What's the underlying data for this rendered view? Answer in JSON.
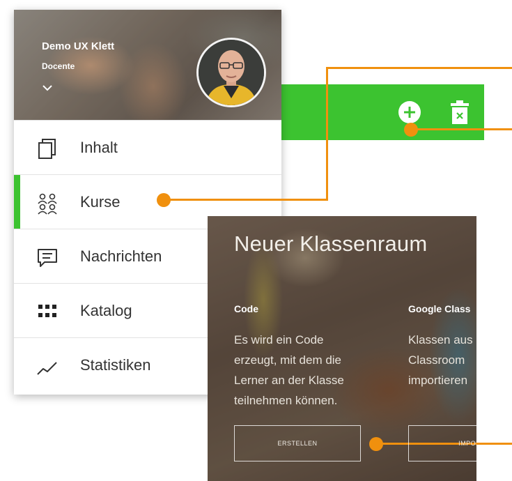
{
  "profile": {
    "name": "Demo UX Klett",
    "role": "Docente"
  },
  "menu": {
    "items": [
      {
        "label": "Inhalt",
        "icon": "stack-pages-icon",
        "active": false
      },
      {
        "label": "Kurse",
        "icon": "people-group-icon",
        "active": true
      },
      {
        "label": "Nachrichten",
        "icon": "message-icon",
        "active": false
      },
      {
        "label": "Katalog",
        "icon": "grid-icon",
        "active": false
      },
      {
        "label": "Statistiken",
        "icon": "line-chart-icon",
        "active": false
      }
    ]
  },
  "toolbar": {
    "add_icon": "plus-circle-icon",
    "delete_icon": "trash-icon"
  },
  "classroom": {
    "title": "Neuer Klassenraum",
    "options": [
      {
        "heading": "Code",
        "lines": [
          "Es wird ein Code",
          "erzeugt, mit dem die",
          "Lerner an der Klasse",
          "teilnehmen können."
        ],
        "button": "ERSTELLEN"
      },
      {
        "heading": "Google Class",
        "lines": [
          "Klassen aus",
          "Classroom",
          "importieren"
        ],
        "button": "IMPORT"
      }
    ]
  },
  "colors": {
    "accent_green": "#3cc330",
    "annotation_orange": "#f0900e"
  }
}
